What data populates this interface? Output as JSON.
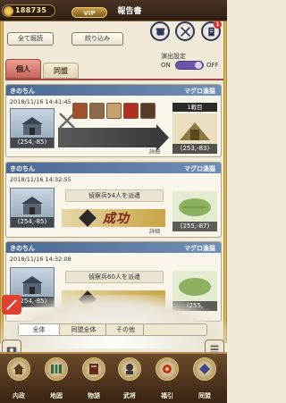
{
  "header": {
    "coins": "188735",
    "vip_label": "VIP",
    "title": "報告書"
  },
  "toolbar": {
    "read_all_label": "全て既読",
    "filter_label": "絞り込み",
    "badge_count": "1",
    "effect_setting_label": "演出設定",
    "toggle_on_label": "ON",
    "toggle_off_label": "OFF"
  },
  "tabs": [
    {
      "label": "個人"
    },
    {
      "label": "同盟"
    }
  ],
  "reports": [
    {
      "name": "きのちん",
      "user": "マグロ漁猫",
      "time": "2018/11/16 14:41:45",
      "origin": "(254,-85)",
      "target": "(253,-83)",
      "battle_label": "1戦目",
      "detail_label": "詳細"
    },
    {
      "name": "きのちん",
      "user": "マグロ漁猫",
      "time": "2018/11/16 14:32:55",
      "mission": "偵察兵54人を派遣",
      "result": "成功",
      "origin": "(254,-85)",
      "target": "(255,-87)",
      "detail_label": "詳細"
    },
    {
      "name": "きのちん",
      "user": "マグロ漁猫",
      "time": "2018/11/16 14:32:08",
      "mission": "偵察兵60人を派遣",
      "origin": "(254,-85)",
      "target": "(255,"
    }
  ],
  "filters": {
    "all": "全体",
    "alliance_all": "同盟全体",
    "other": "その他"
  },
  "nav": [
    {
      "label": "内政",
      "icon": "castle-icon"
    },
    {
      "label": "地図",
      "icon": "map-icon"
    },
    {
      "label": "物語",
      "icon": "book-icon"
    },
    {
      "label": "武将",
      "icon": "warrior-icon"
    },
    {
      "label": "福引",
      "icon": "lottery-icon"
    },
    {
      "label": "同盟",
      "icon": "alliance-icon"
    }
  ],
  "colors": {
    "header_bg": "#3a2818",
    "card_header": "#5a7aa3",
    "tab_active": "#d9776a",
    "toggle": "#6a55a8",
    "success": "#7a2010"
  }
}
